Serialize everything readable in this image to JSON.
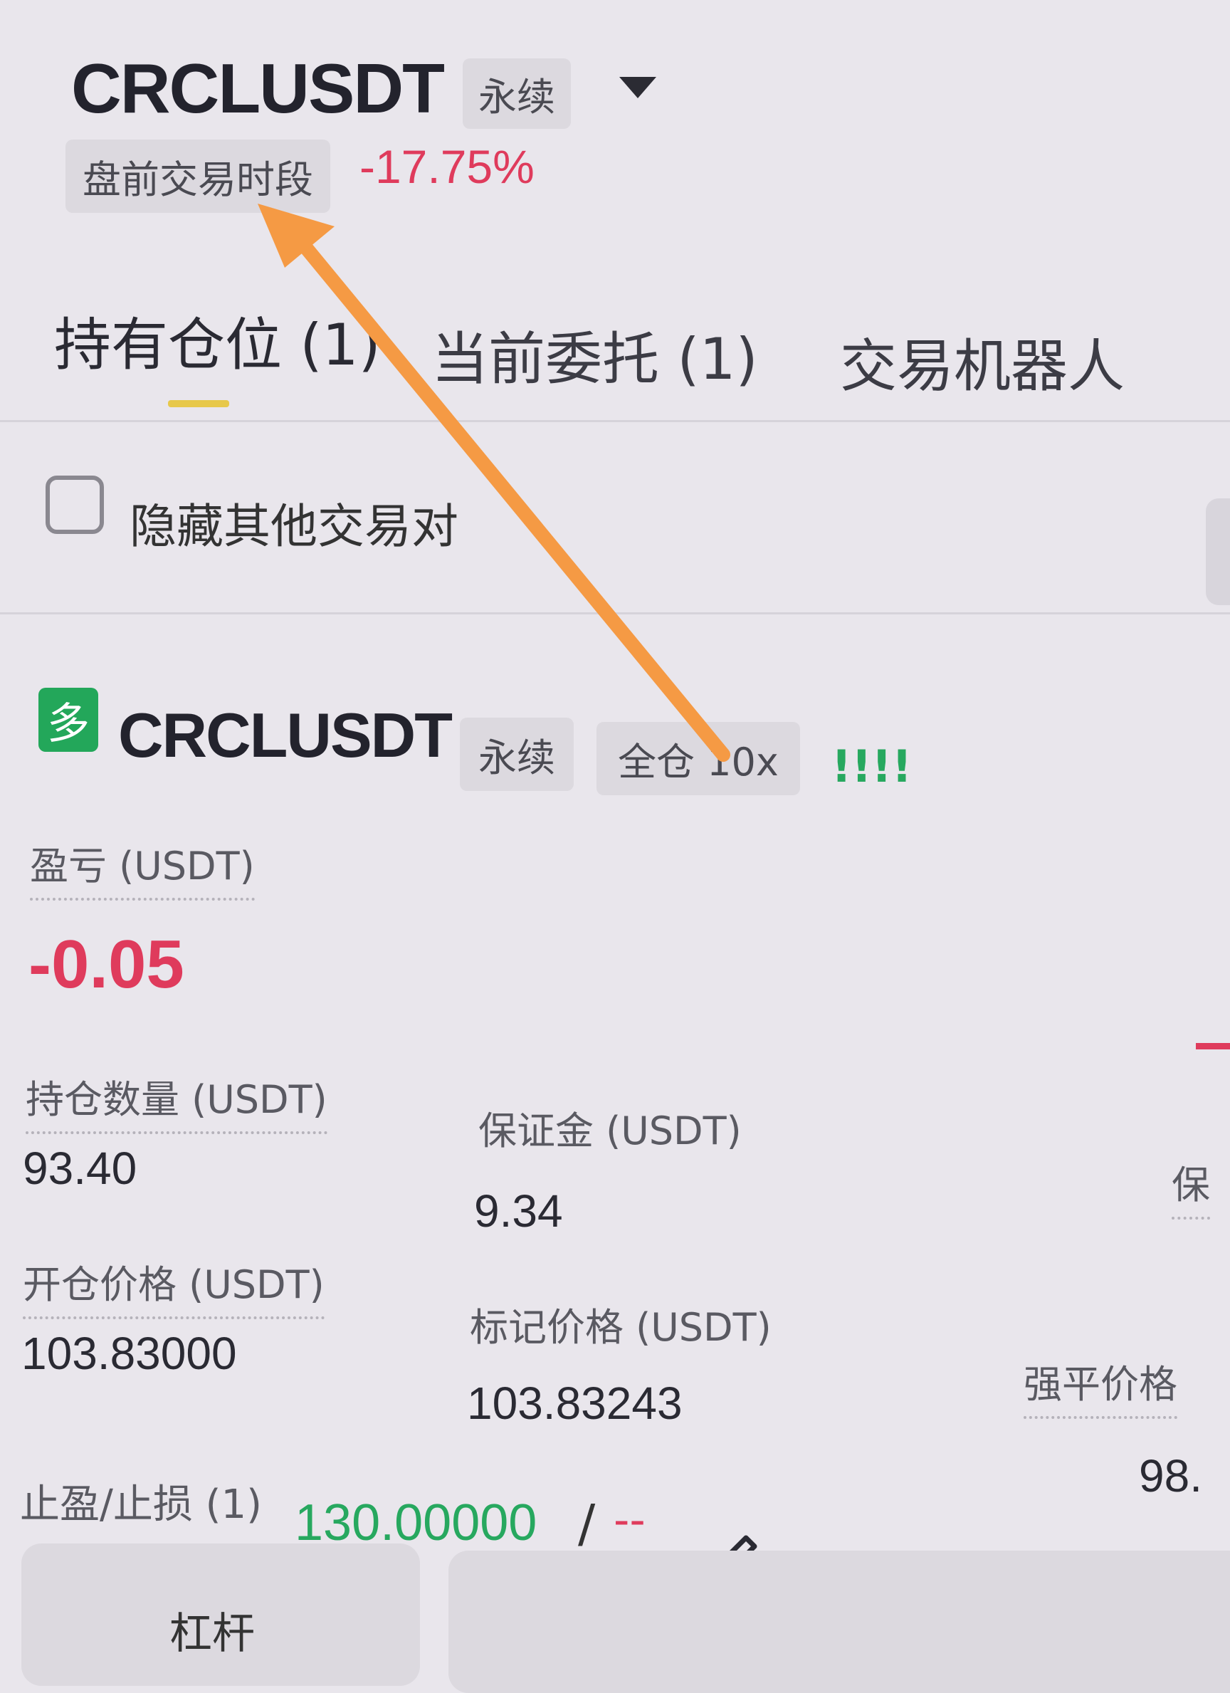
{
  "header": {
    "symbol": "CRCLUSDT",
    "contract_tag": "永续",
    "session_tag": "盘前交易时段",
    "change": "-17.75%"
  },
  "tabs": [
    {
      "label": "持有仓位 (1)"
    },
    {
      "label": "当前委托 (1)"
    },
    {
      "label": "交易机器人"
    }
  ],
  "filter": {
    "hide_other_pairs_label": "隐藏其他交易对"
  },
  "position": {
    "side_badge": "多",
    "symbol": "CRCLUSDT",
    "contract_tag": "永续",
    "margin_tag": "全仓 10x",
    "warning": "!!!!",
    "pnl_label": "盈亏 (USDT)",
    "pnl_value": "-0.05",
    "size_label": "持仓数量 (USDT)",
    "size_value": "93.40",
    "margin_label": "保证金 (USDT)",
    "margin_value": "9.34",
    "margin_ratio_label_partial": "保",
    "entry_label": "开仓价格 (USDT)",
    "entry_value": "103.83000",
    "mark_label": "标记价格 (USDT)",
    "mark_value": "103.83243",
    "liq_label": "强平价格",
    "liq_value_partial": "98.",
    "tpsl_label": "止盈/止损 (1)",
    "tp_value": "130.00000",
    "slash": "/",
    "sl_value": "--",
    "leverage_button": "杠杆"
  },
  "colors": {
    "negative": "#df3b5c",
    "positive": "#27a85f",
    "tab_indicator": "#e7c84a",
    "annotation_arrow": "#f59a44"
  }
}
